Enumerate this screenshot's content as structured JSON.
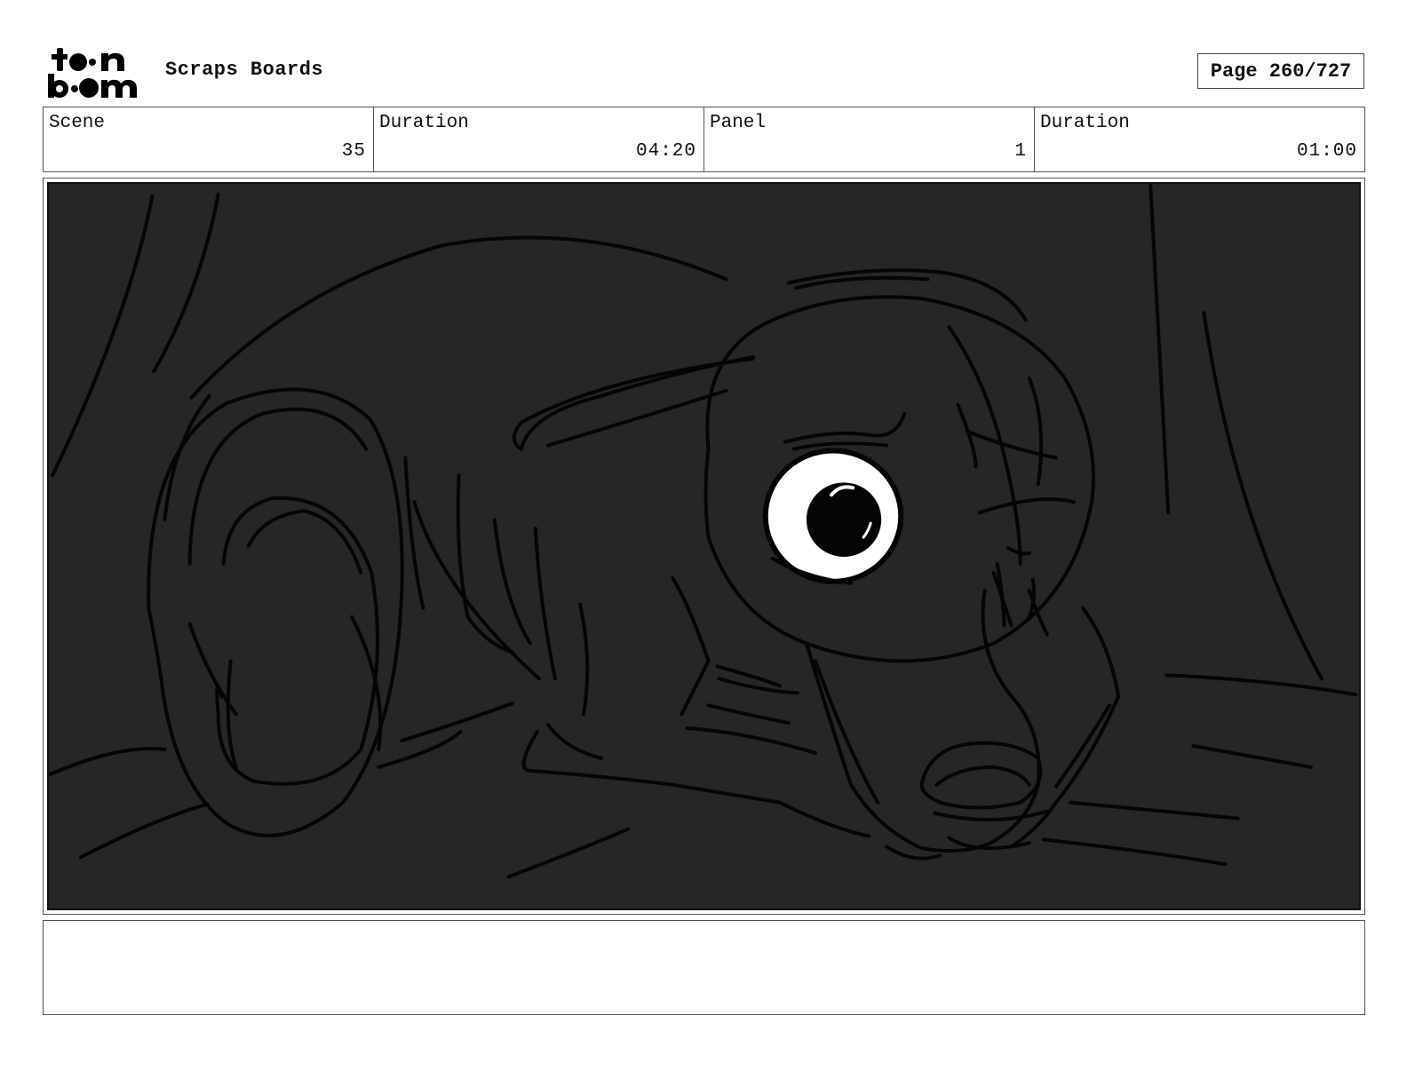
{
  "header": {
    "logo_name": "toon-boom-logo",
    "title": "Scraps Boards",
    "page_label": "Page 260/727"
  },
  "info": [
    {
      "label": "Scene",
      "value": "35"
    },
    {
      "label": "Duration",
      "value": "04:20"
    },
    {
      "label": "Panel",
      "value": "1"
    },
    {
      "label": "Duration",
      "value": "01:00"
    }
  ],
  "panel": {
    "background_color": "#262626",
    "stroke_color": "#050505"
  },
  "notes": {
    "text": ""
  }
}
